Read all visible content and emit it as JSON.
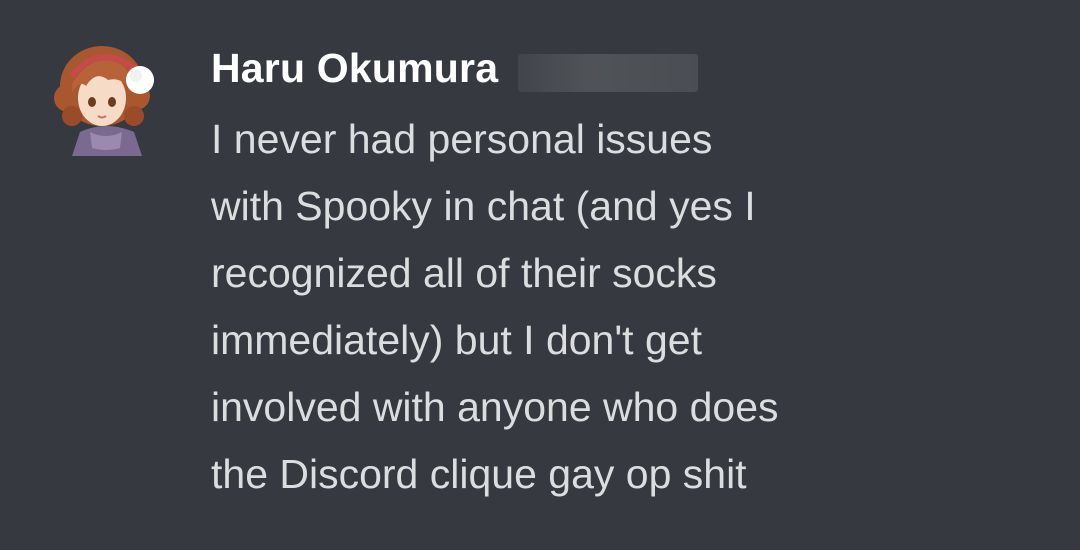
{
  "message": {
    "author": {
      "name": "Haru Okumura",
      "avatar_icon": "haru-okumura-avatar-icon"
    },
    "lines": [
      "I never had personal issues",
      "with Spooky in chat (and yes I",
      "recognized all of their socks",
      "immediately) but I don't get",
      "involved with anyone who does",
      "the Discord clique gay op shit"
    ]
  },
  "colors": {
    "background": "#36393f",
    "username": "#ffffff",
    "text": "#dcddde"
  }
}
